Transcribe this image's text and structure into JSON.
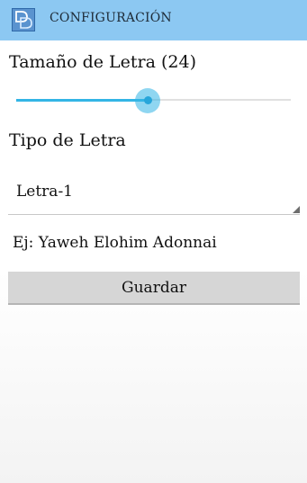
{
  "header": {
    "title": "CONFIGURACIÓN",
    "icon": "app-logo-icon",
    "color": "#8cc8f2"
  },
  "font_size": {
    "label": "Tamaño de Letra (24)",
    "slider_fraction": 0.48,
    "accent_color": "#33b5e5"
  },
  "font_type": {
    "label": "Tipo de Letra",
    "selected": "Letra-1"
  },
  "example": {
    "text": "Ej: Yaweh Elohim Adonnai"
  },
  "save": {
    "label": "Guardar"
  }
}
